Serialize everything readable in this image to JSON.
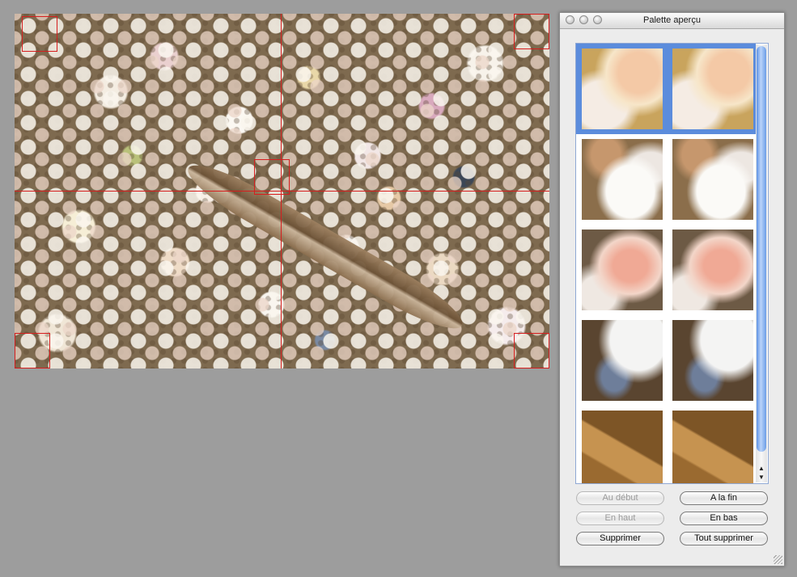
{
  "window": {
    "title": "Palette aperçu"
  },
  "thumbnails": [
    {
      "label": "shells-pink-top",
      "selected": true
    },
    {
      "label": "shells-white-cluster",
      "selected": false
    },
    {
      "label": "shell-pink-closeup",
      "selected": false
    },
    {
      "label": "shell-blue-mussel",
      "selected": false
    },
    {
      "label": "feather-detail",
      "selected": false
    }
  ],
  "buttons": {
    "au_debut": "Au début",
    "a_la_fin": "A la fin",
    "en_haut": "En haut",
    "en_bas": "En bas",
    "supprimer": "Supprimer",
    "tout_supprimer": "Tout supprimer"
  },
  "scrollbar": {
    "up_arrow": "▲",
    "down_arrow": "▼"
  },
  "colors": {
    "accent": "#5b8cdc",
    "marker": "#d61e1e",
    "background": "#9d9d9d"
  }
}
